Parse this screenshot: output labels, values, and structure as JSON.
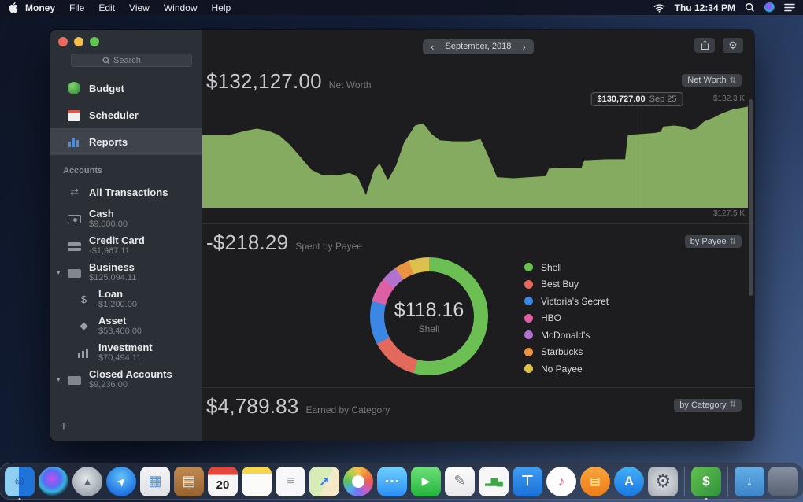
{
  "ui": {
    "updown": "⇅",
    "plus": "+",
    "gear": "⚙"
  },
  "icons": {
    "transactions": "⇄",
    "loan": "$",
    "asset": "◆",
    "disclosure": "▾"
  },
  "menubar": {
    "app_name": "Money",
    "menus": [
      "File",
      "Edit",
      "View",
      "Window",
      "Help"
    ],
    "clock": "Thu 12:34 PM"
  },
  "window": {
    "search_placeholder": "Search",
    "nav": [
      {
        "label": "Budget"
      },
      {
        "label": "Scheduler"
      },
      {
        "label": "Reports"
      }
    ],
    "accounts_header": "Accounts",
    "accounts": [
      {
        "name": "All Transactions",
        "value": ""
      },
      {
        "name": "Cash",
        "value": "$9,000.00"
      },
      {
        "name": "Credit Card",
        "value": "-$1,967.11"
      },
      {
        "name": "Business",
        "value": "$125,094.11"
      },
      {
        "name": "Loan",
        "value": "$1,200.00"
      },
      {
        "name": "Asset",
        "value": "$53,400.00"
      },
      {
        "name": "Investment",
        "value": "$70,494.11"
      },
      {
        "name": "Closed Accounts",
        "value": "$9,236.00"
      }
    ],
    "add_button": "+"
  },
  "header": {
    "period": "September, 2018",
    "prev": "‹",
    "next": "›"
  },
  "sections": {
    "net_worth": {
      "amount": "$132,127.00",
      "caption": "Net Worth",
      "selector": "Net Worth",
      "max_label": "$132.3 K",
      "min_label": "$127.5 K",
      "tooltip_value": "$130,727.00",
      "tooltip_date": "Sep 25"
    },
    "spent": {
      "amount": "-$218.29",
      "caption": "Spent by Payee",
      "selector": "by Payee",
      "donut_value": "$118.16",
      "donut_label": "Shell"
    },
    "earned": {
      "amount": "$4,789.83",
      "caption": "Earned by Category",
      "selector": "by Category"
    }
  },
  "chart_data": [
    {
      "type": "area",
      "title": "Net Worth",
      "color": "#84ab5f",
      "ylim_labels": [
        "$127.5 K",
        "$132.3 K"
      ],
      "marker_x": 80.5,
      "highlight": {
        "value": "$130,727.00",
        "date": "Sep 25"
      },
      "points": [
        [
          0,
          31
        ],
        [
          5,
          31
        ],
        [
          8,
          27
        ],
        [
          10,
          25
        ],
        [
          12,
          27
        ],
        [
          14,
          31
        ],
        [
          16,
          40
        ],
        [
          18,
          52
        ],
        [
          20,
          64
        ],
        [
          22,
          69
        ],
        [
          25,
          69
        ],
        [
          27,
          67
        ],
        [
          28.5,
          71
        ],
        [
          30,
          88
        ],
        [
          31.5,
          64
        ],
        [
          32.5,
          58
        ],
        [
          34,
          74
        ],
        [
          35.5,
          60
        ],
        [
          37,
          38
        ],
        [
          39,
          22
        ],
        [
          40.5,
          20
        ],
        [
          42,
          30
        ],
        [
          43.5,
          36
        ],
        [
          46,
          37
        ],
        [
          49,
          37
        ],
        [
          51,
          35
        ],
        [
          52.5,
          52
        ],
        [
          54,
          71
        ],
        [
          57,
          72
        ],
        [
          60,
          71
        ],
        [
          63,
          70
        ],
        [
          63.5,
          63
        ],
        [
          66,
          62
        ],
        [
          69.5,
          62
        ],
        [
          70,
          55
        ],
        [
          74,
          54
        ],
        [
          77.5,
          54
        ],
        [
          78,
          31
        ],
        [
          80.5,
          30
        ],
        [
          83,
          29
        ],
        [
          84,
          28
        ],
        [
          84.5,
          23
        ],
        [
          86.5,
          22
        ],
        [
          88,
          23
        ],
        [
          89.5,
          26
        ],
        [
          90.5,
          25
        ],
        [
          92,
          18
        ],
        [
          93.5,
          15
        ],
        [
          95,
          11
        ],
        [
          97,
          7
        ],
        [
          100,
          4
        ]
      ]
    },
    {
      "type": "donut",
      "title": "Spent by Payee",
      "total": "-$218.29",
      "center": {
        "value": "$118.16",
        "label": "Shell"
      },
      "segments": [
        {
          "label": "Shell",
          "color": "#6cbf52",
          "deg": 195
        },
        {
          "label": "Best Buy",
          "color": "#e2695c",
          "deg": 47
        },
        {
          "label": "Victoria's Secret",
          "color": "#3d87e4",
          "deg": 43
        },
        {
          "label": "HBO",
          "color": "#dd5fa4",
          "deg": 24
        },
        {
          "label": "McDonald's",
          "color": "#b273cf",
          "deg": 16
        },
        {
          "label": "Starbucks",
          "color": "#e89440",
          "deg": 15
        },
        {
          "label": "No Payee",
          "color": "#dec04f",
          "deg": 20
        }
      ]
    }
  ],
  "dock": {
    "apps": [
      {
        "name": "finder",
        "glyph": "☺",
        "running": true
      },
      {
        "name": "siri",
        "glyph": ""
      },
      {
        "name": "launchpad",
        "glyph": "▲"
      },
      {
        "name": "safari",
        "glyph": "➤"
      },
      {
        "name": "preview",
        "glyph": "▦"
      },
      {
        "name": "contacts",
        "glyph": "▤"
      },
      {
        "name": "calendar",
        "glyph": "20"
      },
      {
        "name": "notes",
        "glyph": ""
      },
      {
        "name": "reminders",
        "glyph": "≡"
      },
      {
        "name": "maps",
        "glyph": "↗"
      },
      {
        "name": "photos",
        "glyph": ""
      },
      {
        "name": "messages",
        "glyph": "…"
      },
      {
        "name": "facetime",
        "glyph": "▶"
      },
      {
        "name": "pages",
        "glyph": "✎"
      },
      {
        "name": "numbers",
        "glyph": "▂▆▄"
      },
      {
        "name": "keynote",
        "glyph": "⊤"
      },
      {
        "name": "itunes",
        "glyph": "♪"
      },
      {
        "name": "books",
        "glyph": "▤"
      },
      {
        "name": "appstore",
        "glyph": "A"
      },
      {
        "name": "settings",
        "glyph": "⚙"
      },
      {
        "name": "separator"
      },
      {
        "name": "money",
        "glyph": "$",
        "running": true
      },
      {
        "name": "separator"
      },
      {
        "name": "downloads",
        "glyph": "↓"
      },
      {
        "name": "trash",
        "glyph": ""
      }
    ]
  }
}
